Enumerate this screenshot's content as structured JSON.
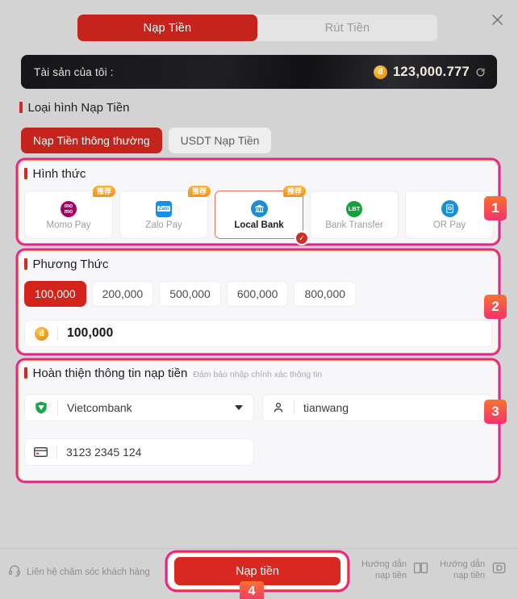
{
  "tabs": [
    {
      "label": "Nạp Tiền",
      "active": true
    },
    {
      "label": "Rút Tiền",
      "active": false
    }
  ],
  "close_icon": "close-icon",
  "balance": {
    "label": "Tài sản của tôi :",
    "currency_symbol": "đ",
    "amount": "123,000.777",
    "refresh_icon": "refresh-icon"
  },
  "deposit_type": {
    "title": "Loại hình Nạp Tiền",
    "options": [
      {
        "label": "Nạp Tiền thông thường",
        "active": true
      },
      {
        "label": "USDT Nạp Tiền",
        "active": false
      }
    ]
  },
  "method_section": {
    "title": "Hình thức",
    "step": "1",
    "recommend_tag": "推荐",
    "methods": [
      {
        "label": "Momo Pay",
        "icon": "momo-icon",
        "recommended": true,
        "selected": false
      },
      {
        "label": "Zalo Pay",
        "icon": "zalopay-icon",
        "recommended": true,
        "selected": false
      },
      {
        "label": "Local Bank",
        "icon": "bank-icon",
        "recommended": true,
        "selected": true
      },
      {
        "label": "Bank Transfer",
        "icon": "lbt-icon",
        "recommended": false,
        "selected": false
      },
      {
        "label": "OR Pay",
        "icon": "qr-pay-icon",
        "recommended": false,
        "selected": false
      }
    ]
  },
  "amount_section": {
    "title": "Phương Thức",
    "step": "2",
    "presets": [
      {
        "label": "100,000",
        "active": true
      },
      {
        "label": "200,000",
        "active": false
      },
      {
        "label": "500,000",
        "active": false
      },
      {
        "label": "600,000",
        "active": false
      },
      {
        "label": "800,000",
        "active": false
      }
    ],
    "input": {
      "currency_symbol": "đ",
      "value": "100,000",
      "placeholder": "100,000"
    }
  },
  "form_section": {
    "title": "Hoàn thiện thông tin nạp tiền",
    "subtitle": "Đảm bảo nhập chính xác thông tin",
    "step": "3",
    "bank": {
      "value": "Vietcombank",
      "placeholder": "Vietcombank",
      "icon": "vietcombank-icon"
    },
    "account_name": {
      "value": "tianwang",
      "placeholder": "tianwang",
      "icon": "user-icon"
    },
    "card_number": {
      "value": "3123 2345 124",
      "placeholder": "3123 2345 124",
      "icon": "card-icon"
    }
  },
  "footer": {
    "support_label": "Liên hệ chăm sóc khách hàng",
    "support_icon": "headset-icon",
    "submit_label": "Nạp tiền",
    "submit_step": "4",
    "guides": [
      {
        "line1": "Hướng dẫn",
        "line2": "nạp tiền",
        "icon": "book-icon"
      },
      {
        "line1": "Hướng dẫn",
        "line2": "nạp tiền",
        "icon": "wallet-icon"
      }
    ]
  },
  "colors": {
    "brand_red": "#c4241c",
    "accent_pink": "#e8218e",
    "accent_orange": "#ee8a5f",
    "badge_gradient_start": "#f9712f",
    "badge_gradient_end": "#f4326e",
    "page_bg": "#d3d3d3"
  }
}
